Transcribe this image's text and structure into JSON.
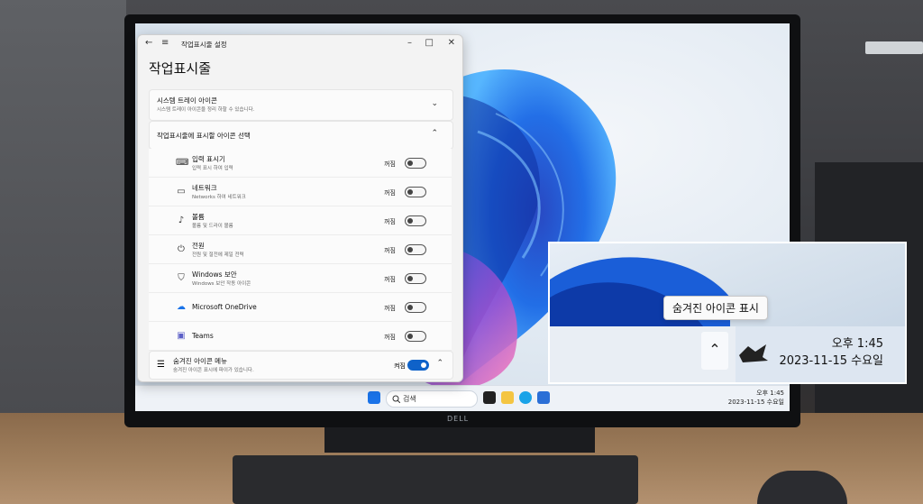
{
  "settings_window": {
    "title": "작업표시줄 설정",
    "page_title": "작업표시줄",
    "tray_group": {
      "label": "시스템 트레이 아이콘",
      "sub": "시스템 트레이 아이콘을 정리 하할 수 있습니다."
    },
    "select_group": {
      "label": "작업표시줄에 표시할 아이콘 선택"
    },
    "items": [
      {
        "icon": "keyboard-icon",
        "label": "입력 표시기",
        "sub": "입력 표시 하여 입력",
        "state": "꺼짐"
      },
      {
        "icon": "network-icon",
        "label": "네트워크",
        "sub": "Networks 하여 네트워크",
        "state": "꺼짐"
      },
      {
        "icon": "volume-icon",
        "label": "볼륨",
        "sub": "볼륨 및 드라이 볼륨",
        "state": "꺼짐"
      },
      {
        "icon": "power-icon",
        "label": "전원",
        "sub": "전원 및 절전에 제일 전력",
        "state": "꺼짐"
      },
      {
        "icon": "shield-icon",
        "label": "Windows 보안",
        "sub": "Windows 보안 작동 아이콘",
        "state": "꺼짐"
      },
      {
        "icon": "cloud-icon",
        "label": "Microsoft OneDrive",
        "sub": "",
        "state": "꺼짐"
      },
      {
        "icon": "teams-icon",
        "label": "Teams",
        "sub": "",
        "state": "꺼짐"
      }
    ],
    "hidden_menu": {
      "label": "숨겨진 아이콘 메뉴",
      "sub": "숨겨진 아이콘 표시에 파이가 있습니다.",
      "state": "켜짐"
    }
  },
  "taskbar": {
    "search": "검색",
    "clock_small_time": "오후 1:45",
    "clock_small_date": "2023-11-15 수요일"
  },
  "callout": {
    "tooltip": "숨겨진 아이콘 표시",
    "overflow_icon": "chevron-up-icon",
    "time": "오후 1:45",
    "date": "2023-11-15 수요일"
  },
  "monitor_brand": "DELL"
}
